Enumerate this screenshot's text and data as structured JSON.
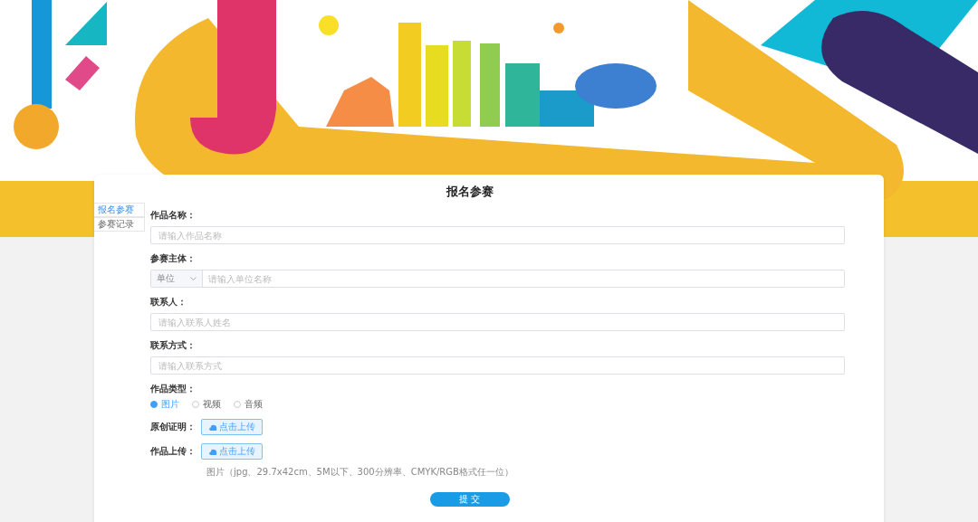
{
  "sidebar": {
    "items": [
      {
        "label": "报名参赛",
        "selected": true
      },
      {
        "label": "参赛记录",
        "selected": false
      }
    ]
  },
  "form": {
    "title": "报名参赛",
    "fields": [
      {
        "kind": "text",
        "label": "作品名称：",
        "placeholder": "请输入作品名称"
      },
      {
        "kind": "select-text",
        "label": "参赛主体：",
        "select_value": "单位",
        "placeholder": "请输入单位名称"
      },
      {
        "kind": "text",
        "label": "联系人：",
        "placeholder": "请输入联系人姓名"
      },
      {
        "kind": "text",
        "label": "联系方式：",
        "placeholder": "请输入联系方式"
      },
      {
        "kind": "radio",
        "label": "作品类型：",
        "options": [
          {
            "label": "图片",
            "selected": true
          },
          {
            "label": "视频",
            "selected": false
          },
          {
            "label": "音频",
            "selected": false
          }
        ]
      },
      {
        "kind": "upload",
        "label": "原创证明：",
        "button": "点击上传"
      },
      {
        "kind": "upload",
        "label": "作品上传：",
        "button": "点击上传",
        "hint": "图片（jpg、29.7x42cm、5M以下、300分辨率、CMYK/RGB格式任一位）"
      }
    ],
    "submit": "提 交"
  }
}
